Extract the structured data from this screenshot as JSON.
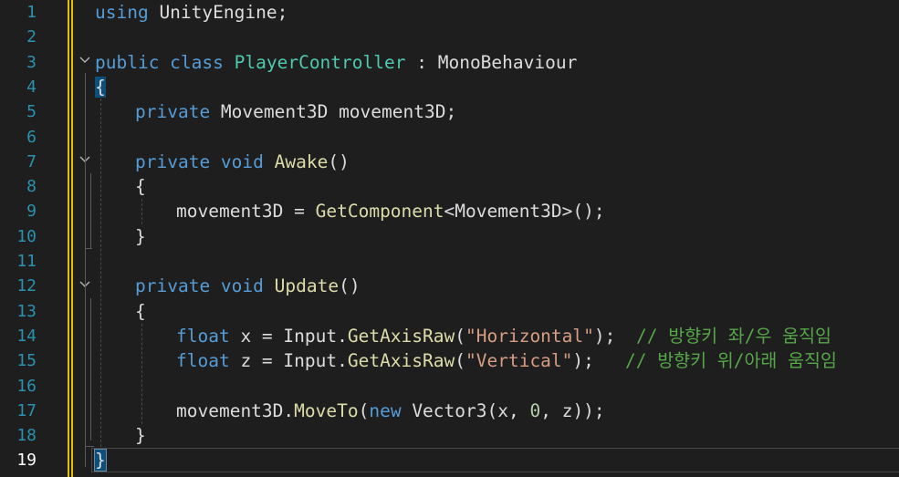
{
  "editor": {
    "language": "csharp",
    "current_line": 19,
    "colors": {
      "background": "#1e1e1e",
      "keyword": "#569cd6",
      "type": "#4ec9b0",
      "method": "#dcdcaa",
      "string": "#d69d85",
      "number": "#b5cea8",
      "comment": "#57a64a",
      "line_number": "#2b91af",
      "change_marker": "#e6c000"
    },
    "line_numbers": [
      "1",
      "2",
      "3",
      "4",
      "5",
      "6",
      "7",
      "8",
      "9",
      "10",
      "11",
      "12",
      "13",
      "14",
      "15",
      "16",
      "17",
      "18",
      "19"
    ],
    "code": {
      "l1": {
        "kw": "using",
        "rest": " UnityEngine;"
      },
      "l3": {
        "kw": "public class",
        "cls": "PlayerController",
        "sep": " : ",
        "base": "MonoBehaviour"
      },
      "l4": {
        "brace": "{"
      },
      "l5": {
        "kw": "private",
        "rest": " Movement3D movement3D;"
      },
      "l7": {
        "kw": "private void",
        "fn": "Awake",
        "rest": "()"
      },
      "l8": {
        "brace": "{"
      },
      "l9": {
        "a": "movement3D = ",
        "fn": "GetComponent",
        "b": "<Movement3D>();"
      },
      "l10": {
        "brace": "}"
      },
      "l12": {
        "kw": "private void",
        "fn": "Update",
        "rest": "()"
      },
      "l13": {
        "brace": "{"
      },
      "l14": {
        "kw": "float",
        "a": " x = Input.",
        "fn": "GetAxisRaw",
        "b": "(",
        "str": "\"Horizontal\"",
        "c": ");",
        "comment": "// 방향키 좌/우 움직임"
      },
      "l15": {
        "kw": "float",
        "a": " z = Input.",
        "fn": "GetAxisRaw",
        "b": "(",
        "str": "\"Vertical\"",
        "c": ");",
        "comment": "// 방향키 위/아래 움직임"
      },
      "l17": {
        "a": "movement3D.",
        "fn": "MoveTo",
        "b": "(",
        "kw": "new",
        "c": " Vector3(x, ",
        "num": "0",
        "d": ", z));"
      },
      "l18": {
        "brace": "}"
      },
      "l19": {
        "brace": "}"
      }
    },
    "fold_icons": [
      "chevron-down",
      "chevron-down",
      "chevron-down"
    ]
  }
}
